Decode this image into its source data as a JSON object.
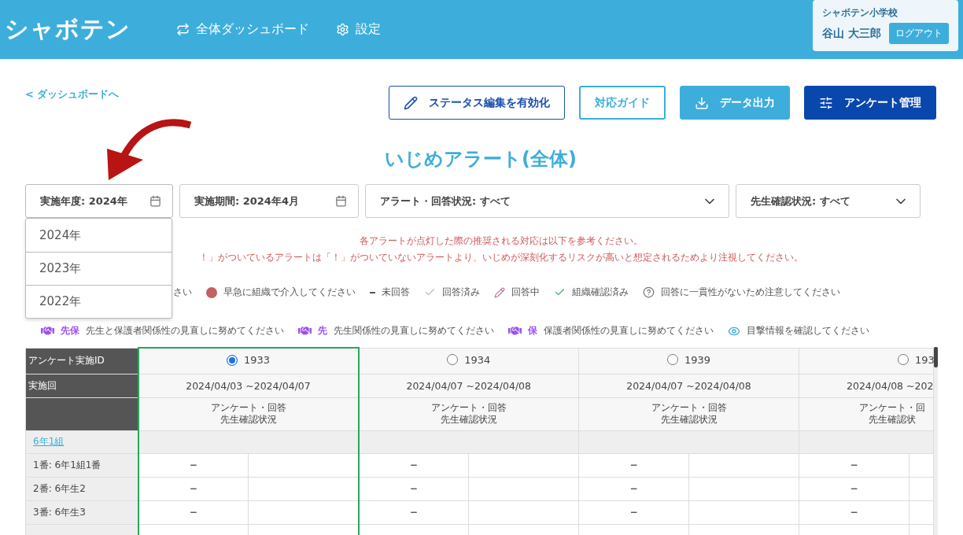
{
  "header": {
    "logo": "シャボテン",
    "nav": [
      {
        "kind": "swap",
        "label": "全体ダッシュボード"
      },
      {
        "kind": "gear",
        "label": "設定"
      }
    ],
    "user": {
      "school": "シャボテン小学校",
      "name": "谷山 大三郎",
      "logout": "ログアウト"
    }
  },
  "back_link": "< ダッシュボードへ",
  "actions": [
    {
      "kind": "edit",
      "label": "ステータス編集を有効化"
    },
    {
      "kind": "guide",
      "label": "対応ガイド"
    },
    {
      "kind": "export",
      "label": "データ出力"
    },
    {
      "kind": "manage",
      "label": "アンケート管理"
    }
  ],
  "title": "いじめアラート(全体)",
  "filters": [
    {
      "kind": "date",
      "label": "実施年度: 2024年",
      "expanded": true,
      "options": [
        "2024年",
        "2023年",
        "2022年"
      ]
    },
    {
      "kind": "date",
      "label": "実施期間: 2024年4月",
      "expanded": false
    },
    {
      "kind": "select",
      "label": "アラート・回答状況: すべて",
      "expanded": false
    },
    {
      "kind": "select",
      "label": "先生確認状況: すべて",
      "expanded": false
    }
  ],
  "notice": [
    "各アラートが点灯した際の推奨される対応は以下を参考ください。",
    "！」がついているアラートは「！」がついていないアラートより、いじめが深刻化するリスクが高いと想定されるためより注視してください。"
  ],
  "legend": [
    [
      {
        "kind": "none",
        "text": "さい"
      },
      {
        "kind": "dot",
        "text": "早急に組織で介入してください"
      },
      {
        "kind": "dash",
        "text": "未回答"
      },
      {
        "kind": "grey-check",
        "text": "回答済み"
      },
      {
        "kind": "pencil",
        "text": "回答中"
      },
      {
        "kind": "green-check",
        "text": "組織確認済み"
      },
      {
        "kind": "question",
        "text": "回答に一貫性がないため注意してください"
      }
    ],
    [
      {
        "kind": "handshake",
        "tag": "先保",
        "text": "先生と保護者関係性の見直しに努めてください"
      },
      {
        "kind": "handshake",
        "tag": "先",
        "text": "先生関係性の見直しに努めてください"
      },
      {
        "kind": "handshake",
        "tag": "保",
        "text": "保護者関係性の見直しに努めてください"
      },
      {
        "kind": "eye",
        "text": "目撃情報を確認してください"
      }
    ]
  ],
  "table": {
    "id_label": "アンケート実施ID",
    "round_label": "実施回",
    "columns": [
      {
        "id": "1933",
        "selected": true,
        "period": "2024/04/03 ~2024/04/07",
        "status": [
          "アンケート・回答",
          "先生確認状況"
        ]
      },
      {
        "id": "1934",
        "selected": false,
        "period": "2024/04/07 ~2024/04/08",
        "status": [
          "アンケート・回答",
          "先生確認状況"
        ]
      },
      {
        "id": "1939",
        "selected": false,
        "period": "2024/04/07 ~2024/04/08",
        "status": [
          "アンケート・回答",
          "先生確認状況"
        ]
      },
      {
        "id": "193",
        "selected": false,
        "period": "2024/04/08 ~202",
        "status": [
          "アンケート・回",
          "先生確認状"
        ]
      }
    ],
    "group": "6年1組",
    "students": [
      {
        "name": "1番: 6年1組1番",
        "marks": [
          "−",
          "−",
          "−",
          "−"
        ]
      },
      {
        "name": "2番: 6年生2",
        "marks": [
          "−",
          "−",
          "−",
          "−"
        ]
      },
      {
        "name": "3番: 6年生3",
        "marks": [
          "−",
          "−",
          "−",
          "−"
        ]
      }
    ]
  }
}
